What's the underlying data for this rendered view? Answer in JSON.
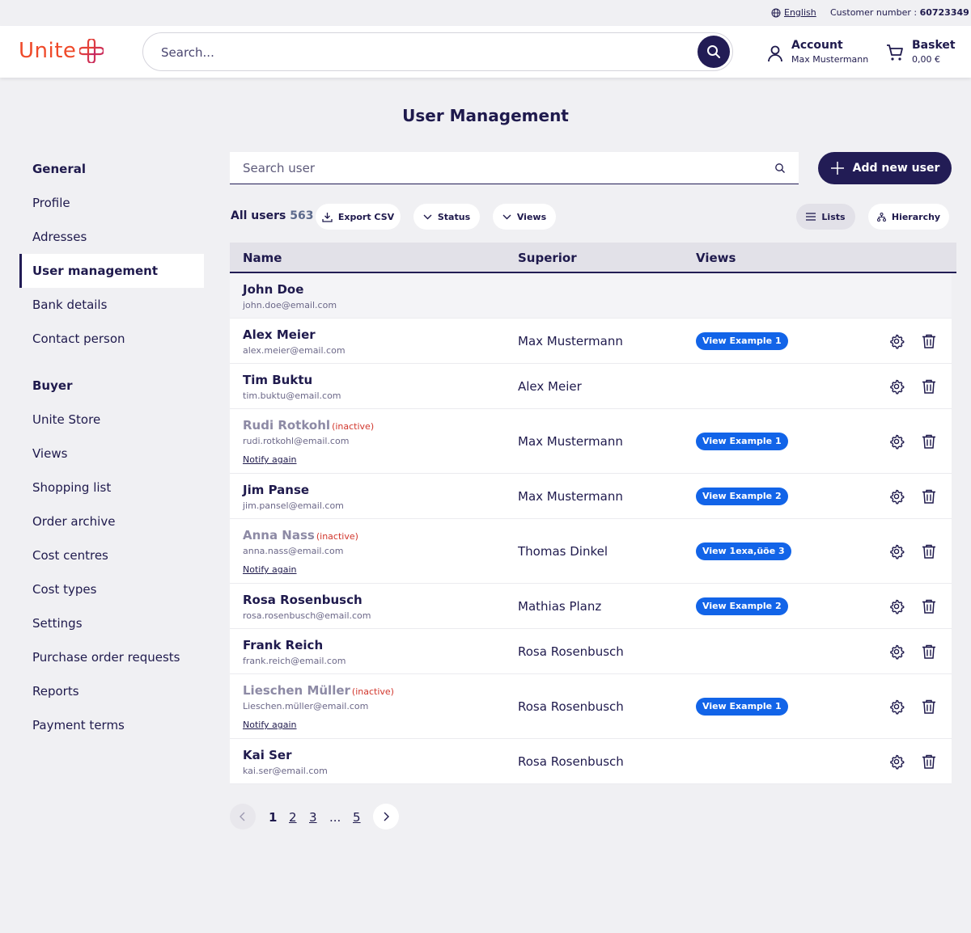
{
  "topbar": {
    "language": "English",
    "customer_label": "Customer number :",
    "customer_number": "60723349"
  },
  "header": {
    "logo_text": "Unite",
    "search_placeholder": "Search...",
    "account_title": "Account",
    "account_name": "Max Mustermann",
    "basket_title": "Basket",
    "basket_amount": "0,00 €"
  },
  "page": {
    "title": "User Management"
  },
  "sidebar": {
    "groups": [
      {
        "title": "General",
        "items": [
          "Profile",
          "Adresses",
          "User management",
          "Bank details",
          "Contact person"
        ]
      },
      {
        "title": "Buyer",
        "items": [
          "Unite Store",
          "Views",
          "Shopping list",
          "Order archive",
          "Cost centres",
          "Cost types",
          "Settings",
          "Purchase order requests",
          "Reports",
          "Payment terms"
        ]
      }
    ],
    "active": "User management"
  },
  "toolbar": {
    "search_placeholder": "Search user",
    "add_button": "Add new user",
    "all_users_label": "All users",
    "all_users_count": "563",
    "export_label": "Export CSV",
    "status_label": "Status",
    "views_label": "Views",
    "lists_label": "Lists",
    "hierarchy_label": "Hierarchy"
  },
  "table": {
    "headers": [
      "Name",
      "Superior",
      "Views"
    ],
    "inactive_label": "(inactive)",
    "notify_label": "Notify again",
    "rows": [
      {
        "name": "John Doe",
        "email": "john.doe@email.com",
        "superior": "",
        "view": "",
        "inactive": false
      },
      {
        "name": "Alex Meier",
        "email": "alex.meier@email.com",
        "superior": "Max Mustermann",
        "view": "View Example 1",
        "inactive": false
      },
      {
        "name": "Tim Buktu",
        "email": "tim.buktu@email.com",
        "superior": "Alex Meier",
        "view": "",
        "inactive": false
      },
      {
        "name": "Rudi Rotkohl",
        "email": "rudi.rotkohl@email.com",
        "superior": "Max Mustermann",
        "view": "View Example 1",
        "inactive": true
      },
      {
        "name": "Jim Panse",
        "email": "jim.pansel@email.com",
        "superior": "Max Mustermann",
        "view": "View Example 2",
        "inactive": false
      },
      {
        "name": "Anna Nass",
        "email": "anna.nass@email.com",
        "superior": "Thomas Dinkel",
        "view": "View 1exa,üöe 3",
        "inactive": true
      },
      {
        "name": "Rosa Rosenbusch",
        "email": "rosa.rosenbusch@email.com",
        "superior": "Mathias Planz",
        "view": "View Example 2",
        "inactive": false
      },
      {
        "name": "Frank Reich",
        "email": "frank.reich@email.com",
        "superior": "Rosa Rosenbusch",
        "view": "",
        "inactive": false
      },
      {
        "name": "Lieschen Müller",
        "email": "Lieschen.müller@email.com",
        "superior": "Rosa Rosenbusch",
        "view": "View Example 1",
        "inactive": true
      },
      {
        "name": "Kai Ser",
        "email": "kai.ser@email.com",
        "superior": "Rosa Rosenbusch",
        "view": "",
        "inactive": false
      }
    ]
  },
  "pagination": {
    "pages": [
      "1",
      "2",
      "3",
      "...",
      "5"
    ],
    "current": "1"
  },
  "colors": {
    "primary": "#221c55",
    "brand": "#ef4a2a",
    "badge": "#1264e8",
    "inactive": "#d1362c"
  }
}
